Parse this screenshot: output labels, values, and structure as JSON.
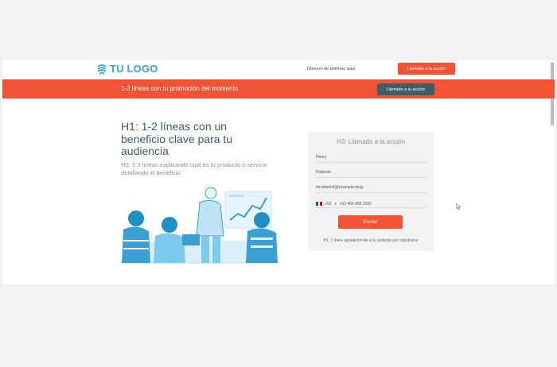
{
  "header": {
    "logo_text": "TU LOGO",
    "phone_text": "Número de teléfono aquí",
    "cta_label": "Llamado a la acción"
  },
  "promo": {
    "text": "1-2 líneas con tu promoción del momento",
    "cta_label": "Llamado a la acción"
  },
  "hero": {
    "h1": "H1: 1-2 líneas con un beneficio clave para tu audiencia",
    "h3": "H3: 1-3 líneas explicando cuál es tu producto o servicio detallando el beneficio"
  },
  "form": {
    "title": "H3: Llamado a la acción",
    "first_name": "Henry",
    "last_name": "Robledo",
    "email": "mrobledo4@example.mcjp",
    "phone_code": "+52",
    "phone_number": "+52 466 405 2035",
    "submit_label": "Enviar",
    "thanks_text": "H1: 1 línea agradeciendo a tu visitante por registrarse"
  },
  "colors": {
    "accent": "#f25236",
    "dark": "#3f5c68",
    "brand": "#3a9fd3",
    "background": "#f1f2f4"
  },
  "icons": [
    "logo-swirl-icon",
    "mexico-flag-icon",
    "chevron-down-icon",
    "mouse-cursor-icon"
  ]
}
